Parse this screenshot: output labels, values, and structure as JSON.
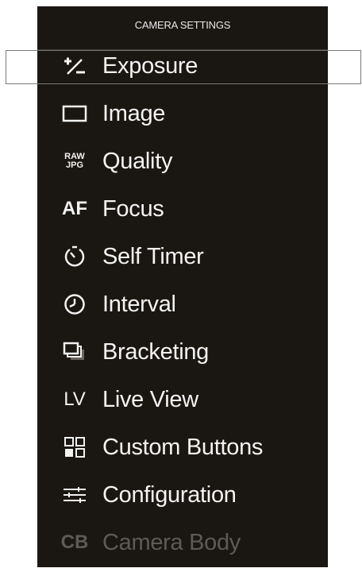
{
  "header": {
    "title": "CAMERA SETTINGS"
  },
  "menu": {
    "items": [
      {
        "label": "Exposure",
        "icon": "exposure-compensation-icon",
        "selected": true,
        "enabled": true
      },
      {
        "label": "Image",
        "icon": "image-frame-icon",
        "enabled": true
      },
      {
        "label": "Quality",
        "icon": "raw-jpg-icon",
        "icon_text_top": "RAW",
        "icon_text_bottom": "JPG",
        "enabled": true
      },
      {
        "label": "Focus",
        "icon": "af-icon",
        "icon_text": "AF",
        "enabled": true
      },
      {
        "label": "Self Timer",
        "icon": "self-timer-icon",
        "enabled": true
      },
      {
        "label": "Interval",
        "icon": "clock-icon",
        "enabled": true
      },
      {
        "label": "Bracketing",
        "icon": "bracketing-icon",
        "enabled": true
      },
      {
        "label": "Live View",
        "icon": "live-view-icon",
        "icon_text": "LV",
        "enabled": true
      },
      {
        "label": "Custom Buttons",
        "icon": "custom-buttons-icon",
        "enabled": true
      },
      {
        "label": "Configuration",
        "icon": "configuration-sliders-icon",
        "enabled": true
      },
      {
        "label": "Camera Body",
        "icon": "camera-body-icon",
        "icon_text": "CB",
        "enabled": false
      }
    ]
  },
  "colors": {
    "background": "#1a1611",
    "text": "#f4f4f4",
    "disabled_text": "#5e5a55",
    "selection_border": "#7a7a7a"
  }
}
